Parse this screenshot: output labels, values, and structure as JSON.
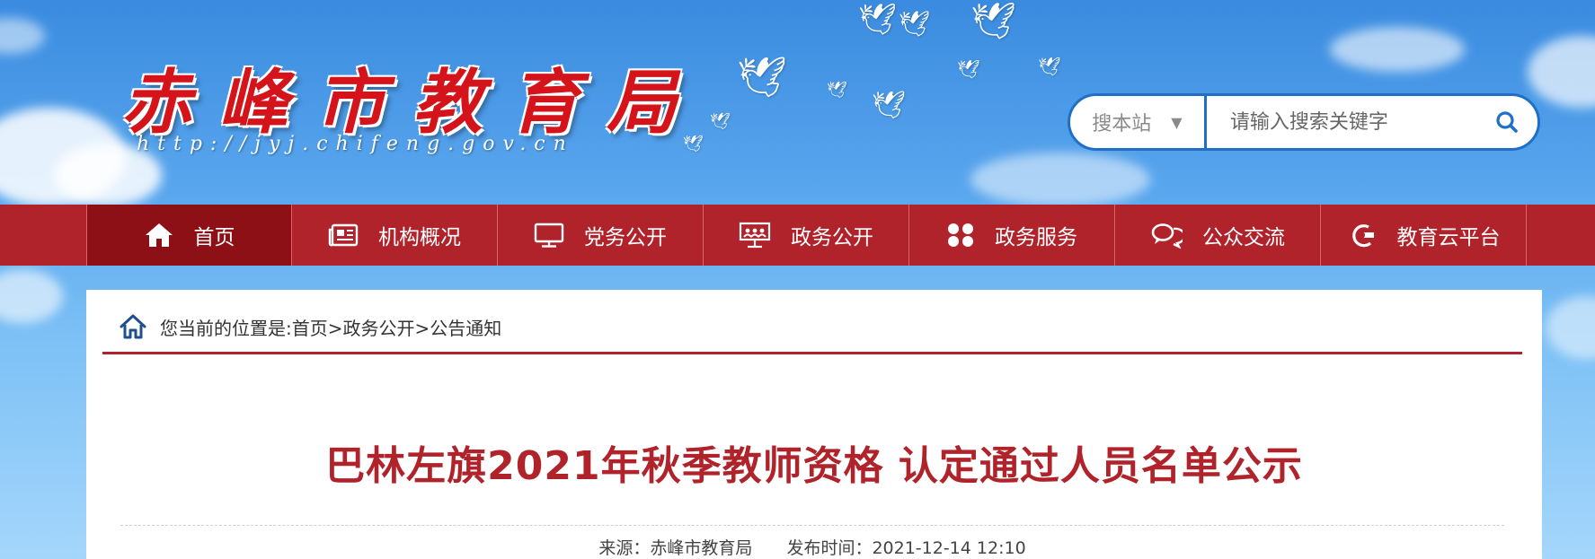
{
  "header": {
    "site_title": "赤峰市教育局",
    "site_url": "http://jyj.chifeng.gov.cn"
  },
  "search": {
    "scope_label": "搜本站",
    "scope_arrow": "▼",
    "placeholder": "请输入搜索关键字",
    "icon": "search-icon"
  },
  "nav": {
    "items": [
      {
        "label": "首页",
        "icon": "home-icon",
        "active": true
      },
      {
        "label": "机构概况",
        "icon": "newspaper-icon"
      },
      {
        "label": "党务公开",
        "icon": "monitor-icon"
      },
      {
        "label": "政务公开",
        "icon": "presentation-icon"
      },
      {
        "label": "政务服务",
        "icon": "grid-icon"
      },
      {
        "label": "公众交流",
        "icon": "chat-icon"
      },
      {
        "label": "教育云平台",
        "icon": "cloud-icon"
      }
    ]
  },
  "breadcrumb": {
    "text": "您当前的位置是:首页>政务公开>公告通知",
    "icon": "home-icon"
  },
  "article": {
    "title": "巴林左旗2021年秋季教师资格 认定通过人员名单公示",
    "source_label": "来源：赤峰市教育局",
    "date_label": "发布时间：2021-12-14 12:10"
  },
  "colors": {
    "brand_red": "#b0232b",
    "nav_active": "#8c1016",
    "search_blue": "#1f6fc8"
  }
}
